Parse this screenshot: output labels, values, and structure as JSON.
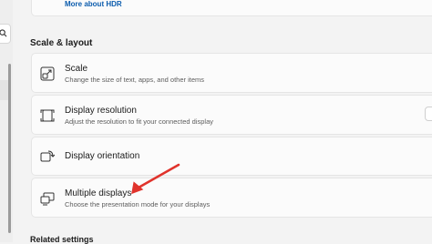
{
  "hdr": {
    "more_about_hdr": "More about HDR"
  },
  "section": {
    "title": "Scale & layout"
  },
  "cards": [
    {
      "title": "Scale",
      "subtitle": "Change the size of text, apps, and other items",
      "icon": "scale-icon"
    },
    {
      "title": "Display resolution",
      "subtitle": "Adjust the resolution to fit your connected display",
      "icon": "resolution-icon"
    },
    {
      "title": "Display orientation",
      "subtitle": "",
      "icon": "orientation-icon"
    },
    {
      "title": "Multiple displays",
      "subtitle": "Choose the presentation mode for your displays",
      "icon": "multiple-displays-icon"
    }
  ],
  "footer": {
    "related_settings": "Related settings"
  },
  "colors": {
    "accent": "#0b5cad",
    "annotation_arrow": "#e0332c",
    "card_bg": "#fbfbfb",
    "page_bg": "#f3f3f3"
  }
}
